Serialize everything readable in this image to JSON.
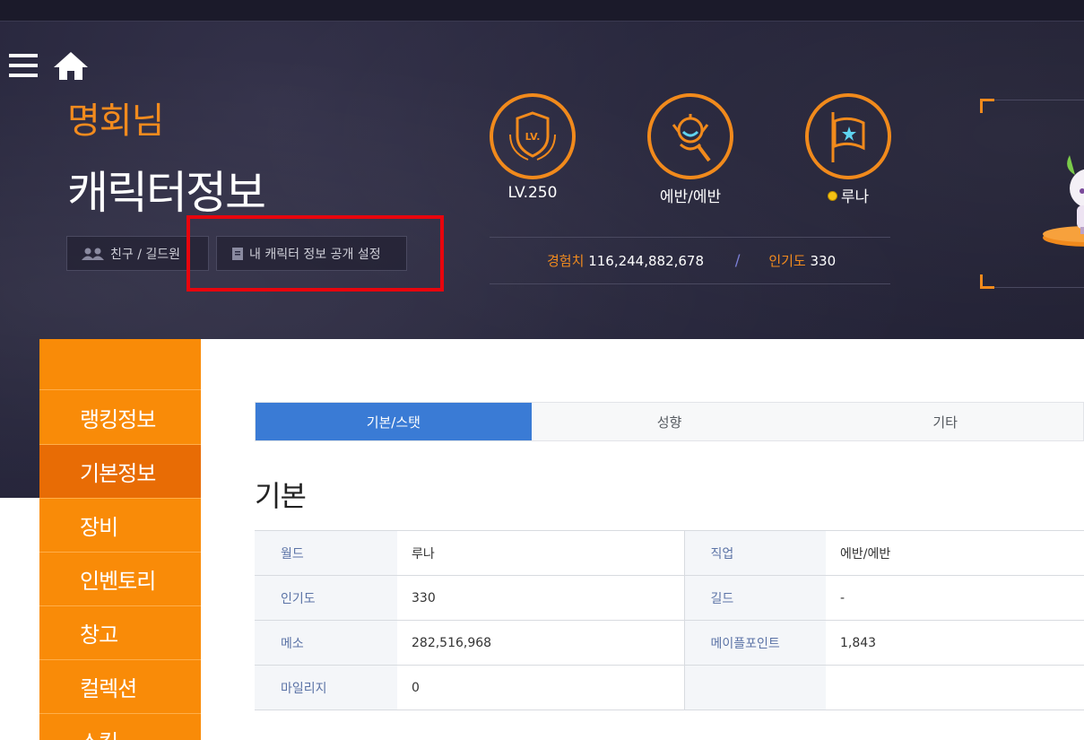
{
  "header": {
    "name": "명회님",
    "title": "캐릭터정보",
    "buttons": {
      "friend_guild": "친구 / 길드원",
      "privacy_settings": "내 캐릭터 정보 공개 설정"
    }
  },
  "stats": {
    "level": "LV.250",
    "job": "에반/에반",
    "world": "루나",
    "exp_label": "경험치",
    "exp_value": "116,244,882,678",
    "popularity_label": "인기도",
    "popularity_value": "330"
  },
  "sidebar": {
    "items": [
      {
        "label": "랭킹정보",
        "active": false
      },
      {
        "label": "기본정보",
        "active": true
      },
      {
        "label": "장비",
        "active": false
      },
      {
        "label": "인벤토리",
        "active": false
      },
      {
        "label": "창고",
        "active": false
      },
      {
        "label": "컬렉션",
        "active": false
      },
      {
        "label": "스킬",
        "active": false
      }
    ]
  },
  "tabs": [
    {
      "label": "기본/스탯",
      "active": true
    },
    {
      "label": "성향",
      "active": false
    },
    {
      "label": "기타",
      "active": false
    }
  ],
  "section": {
    "title": "기본"
  },
  "basic_info": {
    "rows": [
      {
        "k1": "월드",
        "v1": "루나",
        "k2": "직업",
        "v2": "에반/에반"
      },
      {
        "k1": "인기도",
        "v1": "330",
        "k2": "길드",
        "v2": "-"
      },
      {
        "k1": "메소",
        "v1": "282,516,968",
        "k2": "메이플포인트",
        "v2": "1,843"
      },
      {
        "k1": "마일리지",
        "v1": "0",
        "k2": "",
        "v2": ""
      }
    ]
  },
  "colors": {
    "accent_orange": "#f98b08",
    "active_blue": "#3a7bd5",
    "highlight_red": "#e8050d",
    "hero_bg": "#25243a"
  },
  "icons": [
    "menu-icon",
    "home-icon",
    "friends-icon",
    "document-icon",
    "level-shield-icon",
    "job-emblem-icon",
    "world-flag-icon",
    "coin-icon"
  ]
}
